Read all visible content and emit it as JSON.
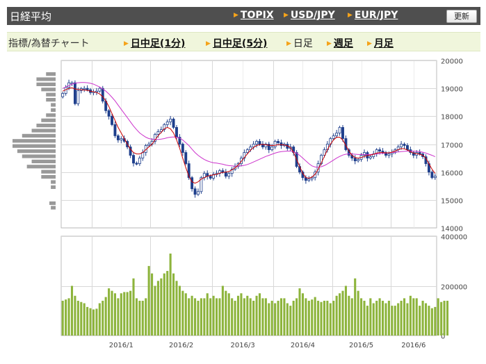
{
  "header": {
    "title": "日経平均",
    "links": [
      {
        "label": "TOPIX"
      },
      {
        "label": "USD/JPY"
      },
      {
        "label": "EUR/JPY"
      }
    ],
    "refresh_label": "更新"
  },
  "subbar": {
    "label": "指標/為替チャート",
    "timeframes": [
      {
        "label": "日中足(1分)",
        "link": true
      },
      {
        "label": "日中足(5分)",
        "link": true
      },
      {
        "label": "日足",
        "link": false
      },
      {
        "label": "週足",
        "link": true
      },
      {
        "label": "月足",
        "link": true
      }
    ]
  },
  "colors": {
    "candle": "#1f3f8c",
    "ma_short": "#cc0000",
    "ma_long": "#cc33cc",
    "volume": "#8db43c",
    "volume_profile": "#999999",
    "grid": "#d8d8d8"
  },
  "chart_data": [
    {
      "type": "candlestick",
      "yticks": [
        20000,
        19000,
        18000,
        17000,
        16000,
        15000,
        14000
      ],
      "ylim": [
        14000,
        20000
      ],
      "xtick_labels": [
        "2016/1",
        "2016/2",
        "2016/3",
        "2016/4",
        "2016/5",
        "2016/6"
      ],
      "close": [
        18818,
        19033,
        19200,
        19200,
        18450,
        18920,
        18990,
        19000,
        18950,
        18850,
        18880,
        18900,
        19000,
        18540,
        18200,
        18000,
        17700,
        17300,
        17150,
        17200,
        17100,
        16900,
        16600,
        16320,
        16300,
        16500,
        16700,
        16950,
        17000,
        17100,
        17350,
        17450,
        17520,
        17700,
        17800,
        17900,
        17600,
        17250,
        17000,
        16700,
        16300,
        15800,
        15400,
        15200,
        15300,
        15800,
        15950,
        15850,
        15780,
        15920,
        15950,
        16050,
        16000,
        15850,
        15950,
        16100,
        16200,
        16300,
        16500,
        16700,
        16800,
        16900,
        17000,
        17100,
        17000,
        16900,
        17000,
        16800,
        16900,
        17100,
        17050,
        16950,
        17000,
        16850,
        16900,
        16700,
        16200,
        16000,
        15800,
        15700,
        15750,
        15800,
        16000,
        16300,
        16600,
        16800,
        17000,
        17200,
        17300,
        17400,
        17600,
        17200,
        16800,
        16600,
        16500,
        16400,
        16450,
        16600,
        16700,
        16500,
        16550,
        16650,
        16800,
        16750,
        16700,
        16600,
        16650,
        16700,
        16800,
        16900,
        17000,
        16950,
        16800,
        16700,
        16600,
        16700,
        16650,
        16550,
        16300,
        16000,
        15800,
        15850
      ],
      "ma_short": [
        18900,
        18950,
        19000,
        19020,
        18980,
        18960,
        18950,
        18940,
        18930,
        18900,
        18880,
        18850,
        18800,
        18700,
        18550,
        18350,
        18100,
        17850,
        17600,
        17400,
        17200,
        17000,
        16820,
        16700,
        16650,
        16650,
        16700,
        16800,
        16900,
        17000,
        17150,
        17300,
        17420,
        17550,
        17600,
        17550,
        17400,
        17150,
        16850,
        16500,
        16150,
        15850,
        15650,
        15600,
        15650,
        15750,
        15800,
        15850,
        15880,
        15900,
        15920,
        15960,
        15990,
        16000,
        16020,
        16080,
        16150,
        16250,
        16380,
        16520,
        16650,
        16780,
        16880,
        16950,
        16980,
        16990,
        16980,
        16960,
        16950,
        16960,
        16980,
        16980,
        16970,
        16940,
        16880,
        16700,
        16450,
        16200,
        15950,
        15800,
        15780,
        15820,
        15920,
        16100,
        16320,
        16550,
        16800,
        17000,
        17150,
        17250,
        17250,
        17150,
        16950,
        16750,
        16600,
        16520,
        16500,
        16520,
        16560,
        16590,
        16610,
        16640,
        16680,
        16700,
        16700,
        16690,
        16690,
        16710,
        16750,
        16800,
        16840,
        16830,
        16790,
        16730,
        16680,
        16660,
        16640,
        16600,
        16500,
        16300,
        16100,
        15950
      ],
      "ma_long": [
        19000,
        19050,
        19100,
        19150,
        19180,
        19200,
        19210,
        19210,
        19200,
        19180,
        19150,
        19100,
        19050,
        18980,
        18900,
        18800,
        18680,
        18550,
        18400,
        18250,
        18100,
        17950,
        17800,
        17650,
        17520,
        17400,
        17320,
        17250,
        17200,
        17180,
        17170,
        17170,
        17180,
        17200,
        17230,
        17250,
        17260,
        17250,
        17220,
        17150,
        17050,
        16950,
        16820,
        16700,
        16600,
        16520,
        16450,
        16400,
        16360,
        16330,
        16320,
        16300,
        16280,
        16250,
        16230,
        16220,
        16210,
        16210,
        16220,
        16240,
        16270,
        16310,
        16360,
        16410,
        16460,
        16510,
        16560,
        16600,
        16640,
        16680,
        16710,
        16730,
        16740,
        16750,
        16750,
        16730,
        16680,
        16600,
        16500,
        16400,
        16300,
        16220,
        16180,
        16170,
        16190,
        16230,
        16290,
        16360,
        16430,
        16500,
        16560,
        16610,
        16640,
        16650,
        16650,
        16640,
        16630,
        16630,
        16630,
        16630,
        16630,
        16640,
        16650,
        16660,
        16670,
        16680,
        16690,
        16700,
        16710,
        16720,
        16730,
        16740,
        16750,
        16750,
        16750,
        16740,
        16730,
        16710,
        16680,
        16640,
        16600,
        16550
      ],
      "volume_profile_bars": [
        2,
        4,
        4,
        3,
        2,
        2,
        1,
        1,
        2,
        3,
        4,
        5,
        7,
        9,
        9,
        8,
        7,
        5,
        6,
        3,
        3,
        1,
        1,
        0,
        0,
        0,
        1
      ]
    },
    {
      "type": "bar",
      "yticks": [
        400000,
        200000,
        0
      ],
      "ylim": [
        0,
        400000
      ],
      "values": [
        140000,
        145000,
        150000,
        200000,
        160000,
        140000,
        135000,
        130000,
        115000,
        110000,
        105000,
        108000,
        130000,
        140000,
        155000,
        190000,
        180000,
        170000,
        150000,
        170000,
        175000,
        175000,
        180000,
        230000,
        150000,
        140000,
        140000,
        150000,
        280000,
        250000,
        200000,
        220000,
        230000,
        250000,
        260000,
        330000,
        250000,
        220000,
        200000,
        180000,
        170000,
        150000,
        160000,
        150000,
        140000,
        150000,
        150000,
        170000,
        150000,
        160000,
        150000,
        150000,
        200000,
        180000,
        170000,
        150000,
        140000,
        160000,
        170000,
        150000,
        160000,
        150000,
        140000,
        160000,
        170000,
        150000,
        150000,
        130000,
        140000,
        130000,
        140000,
        150000,
        150000,
        130000,
        120000,
        140000,
        150000,
        190000,
        170000,
        150000,
        140000,
        145000,
        155000,
        140000,
        135000,
        140000,
        140000,
        130000,
        140000,
        160000,
        170000,
        180000,
        200000,
        160000,
        150000,
        230000,
        180000,
        150000,
        140000,
        120000,
        150000,
        130000,
        140000,
        150000,
        140000,
        130000,
        140000,
        120000,
        120000,
        130000,
        140000,
        150000,
        130000,
        160000,
        150000,
        150000,
        120000,
        140000,
        130000,
        120000,
        110000,
        115000,
        150000,
        135000,
        140000,
        140000
      ]
    }
  ]
}
